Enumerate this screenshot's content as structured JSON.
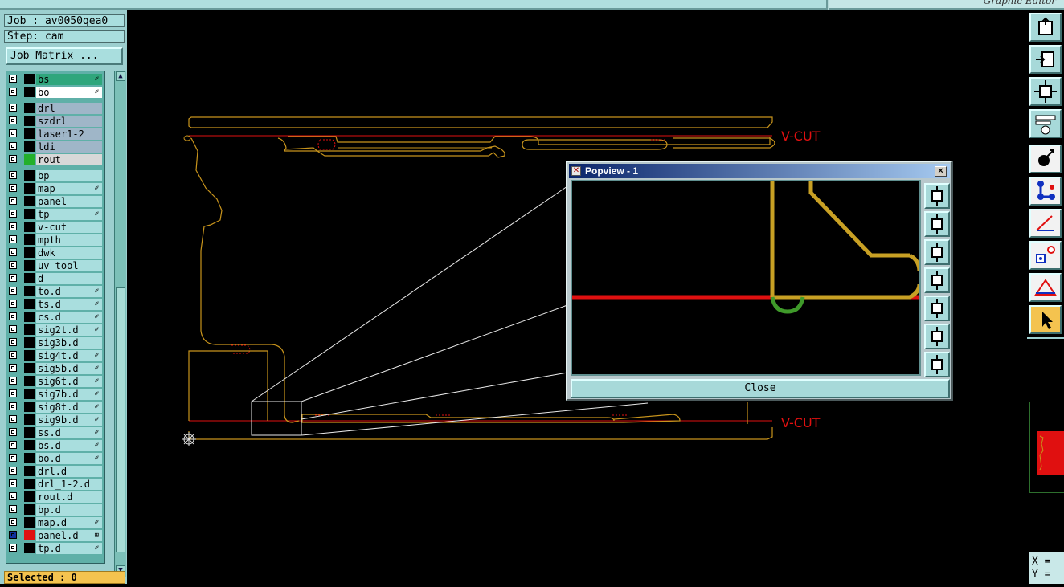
{
  "window": {
    "title": "Graphic Editor"
  },
  "job": {
    "job_label": "Job : av0050qea0",
    "step_label": "Step: cam",
    "matrix_button": "Job Matrix ..."
  },
  "layers": [
    {
      "name": "bs",
      "color": "#000000",
      "bg": "#2fa67c",
      "mark": "✐"
    },
    {
      "name": "bo",
      "color": "#000000",
      "bg": "#ffffff",
      "mark": "✐"
    },
    {
      "name": "drl",
      "color": "#000000",
      "bg": "#9fb6c8",
      "mark": ""
    },
    {
      "name": "szdrl",
      "color": "#000000",
      "bg": "#9fb6c8",
      "mark": ""
    },
    {
      "name": "laser1-2",
      "color": "#000000",
      "bg": "#9fb6c8",
      "mark": ""
    },
    {
      "name": "ldi",
      "color": "#000000",
      "bg": "#9fb6c8",
      "mark": ""
    },
    {
      "name": "rout",
      "color": "#22b02a",
      "bg": "#d8d8d8",
      "mark": ""
    },
    {
      "name": "bp",
      "color": "#000000",
      "bg": "#a9dede",
      "mark": ""
    },
    {
      "name": "map",
      "color": "#000000",
      "bg": "#a9dede",
      "mark": "✐"
    },
    {
      "name": "panel",
      "color": "#000000",
      "bg": "#a9dede",
      "mark": ""
    },
    {
      "name": "tp",
      "color": "#000000",
      "bg": "#a9dede",
      "mark": "✐"
    },
    {
      "name": "v-cut",
      "color": "#000000",
      "bg": "#a9dede",
      "mark": ""
    },
    {
      "name": "mpth",
      "color": "#000000",
      "bg": "#a9dede",
      "mark": ""
    },
    {
      "name": "dwk",
      "color": "#000000",
      "bg": "#a9dede",
      "mark": ""
    },
    {
      "name": "uv_tool",
      "color": "#000000",
      "bg": "#a9dede",
      "mark": ""
    },
    {
      "name": "d",
      "color": "#000000",
      "bg": "#a9dede",
      "mark": ""
    },
    {
      "name": "to.d",
      "color": "#000000",
      "bg": "#a9dede",
      "mark": "✐"
    },
    {
      "name": "ts.d",
      "color": "#000000",
      "bg": "#a9dede",
      "mark": "✐"
    },
    {
      "name": "cs.d",
      "color": "#000000",
      "bg": "#a9dede",
      "mark": "✐"
    },
    {
      "name": "sig2t.d",
      "color": "#000000",
      "bg": "#a9dede",
      "mark": "✐"
    },
    {
      "name": "sig3b.d",
      "color": "#000000",
      "bg": "#a9dede",
      "mark": ""
    },
    {
      "name": "sig4t.d",
      "color": "#000000",
      "bg": "#a9dede",
      "mark": "✐"
    },
    {
      "name": "sig5b.d",
      "color": "#000000",
      "bg": "#a9dede",
      "mark": "✐"
    },
    {
      "name": "sig6t.d",
      "color": "#000000",
      "bg": "#a9dede",
      "mark": "✐"
    },
    {
      "name": "sig7b.d",
      "color": "#000000",
      "bg": "#a9dede",
      "mark": "✐"
    },
    {
      "name": "sig8t.d",
      "color": "#000000",
      "bg": "#a9dede",
      "mark": "✐"
    },
    {
      "name": "sig9b.d",
      "color": "#000000",
      "bg": "#a9dede",
      "mark": "✐"
    },
    {
      "name": "ss.d",
      "color": "#000000",
      "bg": "#a9dede",
      "mark": "✐"
    },
    {
      "name": "bs.d",
      "color": "#000000",
      "bg": "#a9dede",
      "mark": "✐"
    },
    {
      "name": "bo.d",
      "color": "#000000",
      "bg": "#a9dede",
      "mark": "✐"
    },
    {
      "name": "drl.d",
      "color": "#000000",
      "bg": "#a9dede",
      "mark": ""
    },
    {
      "name": "drl_1-2.d",
      "color": "#000000",
      "bg": "#a9dede",
      "mark": ""
    },
    {
      "name": "rout.d",
      "color": "#000000",
      "bg": "#a9dede",
      "mark": ""
    },
    {
      "name": "bp.d",
      "color": "#000000",
      "bg": "#a9dede",
      "mark": ""
    },
    {
      "name": "map.d",
      "color": "#000000",
      "bg": "#a9dede",
      "mark": "✐"
    },
    {
      "name": "panel.d",
      "color": "#e01010",
      "bg": "#a9dede",
      "mark": "⊞"
    },
    {
      "name": "tp.d",
      "color": "#000000",
      "bg": "#a9dede",
      "mark": "✐"
    }
  ],
  "status": {
    "selected": "Selected : 0"
  },
  "canvas": {
    "vcut_top": "V-CUT",
    "vcut_bottom": "V-CUT"
  },
  "popview": {
    "title": "Popview - 1",
    "close_label": "Close",
    "tools": [
      "zoom-fit-icon",
      "pan-up-icon",
      "pan-down-icon",
      "pan-left-icon",
      "pan-right-icon",
      "zoom-in-icon",
      "zoom-out-icon"
    ]
  },
  "right_toolbar": {
    "tools": [
      "zoom-home-icon",
      "zoom-out-icon",
      "fit-view-icon",
      "measure-tools-icon",
      "snap-point-icon",
      "net-connect-icon",
      "angle-icon",
      "feature-select-icon",
      "drc-icon",
      "pointer-arrow-icon"
    ]
  },
  "coords": {
    "x_label": "X = ",
    "y_label": "Y = "
  },
  "colors": {
    "panel": "#9ccfcf",
    "profile": "#c8941c",
    "vcut": "#e01010",
    "selected_bg": "#f4c34f"
  }
}
